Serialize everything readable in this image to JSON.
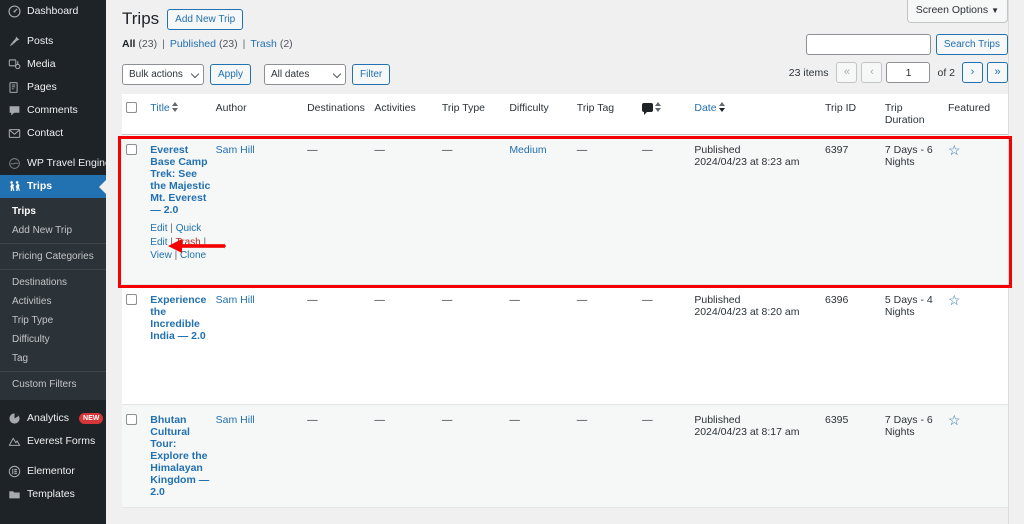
{
  "sidebar": {
    "items": [
      {
        "label": "Dashboard",
        "icon": "dashboard-icon",
        "glyph": "◉"
      },
      {
        "label": "Posts",
        "icon": "pin-icon",
        "glyph": "✎"
      },
      {
        "label": "Media",
        "icon": "media-icon",
        "glyph": "🖼"
      },
      {
        "label": "Pages",
        "icon": "pages-icon",
        "glyph": "📄"
      },
      {
        "label": "Comments",
        "icon": "comment-icon",
        "glyph": "💬"
      },
      {
        "label": "Contact",
        "icon": "envelope-icon",
        "glyph": "✉"
      },
      {
        "label": "WP Travel Engine",
        "icon": "travel-engine-icon",
        "glyph": "⛰"
      },
      {
        "label": "Trips",
        "icon": "trips-icon",
        "glyph": "🚶"
      }
    ],
    "submenu": [
      {
        "label": "Trips",
        "current": true
      },
      {
        "label": "Add New Trip",
        "current": false
      }
    ],
    "submenu_group2": [
      {
        "label": "Pricing Categories"
      }
    ],
    "submenu_group3": [
      {
        "label": "Destinations"
      },
      {
        "label": "Activities"
      },
      {
        "label": "Trip Type"
      },
      {
        "label": "Difficulty"
      },
      {
        "label": "Tag"
      }
    ],
    "custom_filters_label": "Custom Filters",
    "bottom_items": [
      {
        "label": "Analytics",
        "icon": "analytics-icon",
        "glyph": "◔",
        "badge": "NEW"
      },
      {
        "label": "Everest Forms",
        "icon": "everest-forms-icon",
        "glyph": "⛰",
        "badge": ""
      },
      {
        "label": "Elementor",
        "icon": "elementor-icon",
        "glyph": "◫",
        "badge": ""
      },
      {
        "label": "Templates",
        "icon": "templates-icon",
        "glyph": "📁",
        "badge": ""
      }
    ]
  },
  "screen_options": {
    "label": "Screen Options",
    "caret": "▼"
  },
  "header": {
    "title": "Trips",
    "add_new_label": "Add New Trip"
  },
  "views": [
    {
      "label": "All",
      "count": "(23)",
      "current": true
    },
    {
      "label": "Published",
      "count": "(23)",
      "current": false
    },
    {
      "label": "Trash",
      "count": "(2)",
      "current": false
    }
  ],
  "search": {
    "value": "",
    "placeholder": "",
    "button_label": "Search Trips"
  },
  "tablenav": {
    "bulk_actions_label": "Bulk actions",
    "apply_label": "Apply",
    "all_dates_label": "All dates",
    "filter_label": "Filter",
    "items_count": "23 items",
    "first_label": "«",
    "prev_label": "‹",
    "current_page": "1",
    "of_label": "of 2",
    "next_label": "›",
    "last_label": "»"
  },
  "table": {
    "columns": [
      {
        "key": "cb",
        "label": "",
        "sortable": false
      },
      {
        "key": "title",
        "label": "Title",
        "sortable": true
      },
      {
        "key": "author",
        "label": "Author",
        "sortable": false
      },
      {
        "key": "destinations",
        "label": "Destinations",
        "sortable": false
      },
      {
        "key": "activities",
        "label": "Activities",
        "sortable": false
      },
      {
        "key": "trip_type",
        "label": "Trip Type",
        "sortable": false
      },
      {
        "key": "difficulty",
        "label": "Difficulty",
        "sortable": false
      },
      {
        "key": "trip_tag",
        "label": "Trip Tag",
        "sortable": false
      },
      {
        "key": "comments",
        "label": "",
        "sortable": true
      },
      {
        "key": "date",
        "label": "Date",
        "sortable": true
      },
      {
        "key": "trip_id",
        "label": "Trip ID",
        "sortable": false
      },
      {
        "key": "trip_duration",
        "label": "Trip Duration",
        "sortable": false
      },
      {
        "key": "featured",
        "label": "Featured",
        "sortable": false
      }
    ],
    "rows": [
      {
        "title": "Everest Base Camp Trek: See the Majestic Mt. Everest — 2.0",
        "author": "Sam Hill",
        "destinations": "—",
        "activities": "—",
        "trip_type": "—",
        "difficulty": "Medium",
        "trip_tag": "—",
        "comments": "—",
        "date_status": "Published",
        "date_value": "2024/04/23 at 8:23 am",
        "trip_id": "6397",
        "trip_duration": "7 Days - 6 Nights",
        "featured": "☆",
        "actions": [
          "Edit",
          "Quick Edit",
          "Trash",
          "View",
          "Clone"
        ]
      },
      {
        "title": "Experience the Incredible India — 2.0",
        "author": "Sam Hill",
        "destinations": "—",
        "activities": "—",
        "trip_type": "—",
        "difficulty": "—",
        "trip_tag": "—",
        "comments": "—",
        "date_status": "Published",
        "date_value": "2024/04/23 at 8:20 am",
        "trip_id": "6396",
        "trip_duration": "5 Days - 4 Nights",
        "featured": "☆",
        "actions": []
      },
      {
        "title": "Bhutan Cultural Tour: Explore the Himalayan Kingdom — 2.0",
        "author": "Sam Hill",
        "destinations": "—",
        "activities": "—",
        "trip_type": "—",
        "difficulty": "—",
        "trip_tag": "—",
        "comments": "—",
        "date_status": "Published",
        "date_value": "2024/04/23 at 8:17 am",
        "trip_id": "6395",
        "trip_duration": "7 Days - 6 Nights",
        "featured": "☆",
        "actions": []
      }
    ]
  },
  "annotation": {
    "highlight_color": "#f40000",
    "arrow_target": "Edit"
  }
}
